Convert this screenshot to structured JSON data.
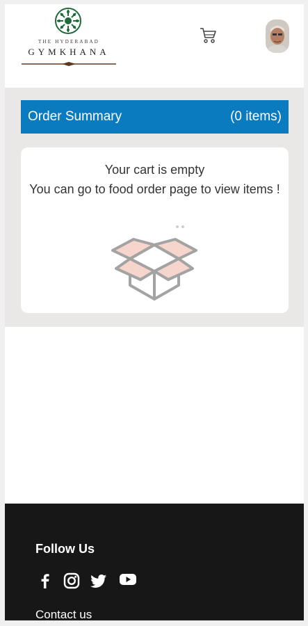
{
  "brand": {
    "line1": "THE HYDERABAD",
    "line2": "GYMKHANA"
  },
  "header": {
    "cart_icon": "cart-icon",
    "avatar": "avatar"
  },
  "order_summary": {
    "title": "Order Summary",
    "count": "(0 items)"
  },
  "cart": {
    "empty_title": "Your cart is empty",
    "empty_hint": "You can go to food order page to view items !",
    "illustration": "open-box-icon"
  },
  "footer": {
    "follow_title": "Follow Us",
    "social": [
      "facebook-icon",
      "instagram-icon",
      "twitter-icon",
      "youtube-icon"
    ],
    "contact_label": "Contact us"
  },
  "colors": {
    "accent": "#0b7bc0",
    "footer_bg": "#171717",
    "band_bg": "#e9e8e6",
    "box_fill": "#f6d5cc",
    "box_stroke": "#a3a3a3",
    "emblem": "#1e6b3a"
  }
}
